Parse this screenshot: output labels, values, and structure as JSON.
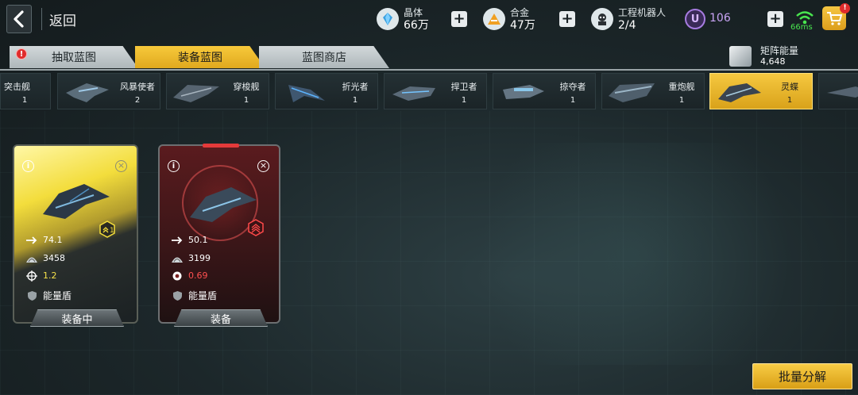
{
  "nav": {
    "back_label": "返回"
  },
  "resources": {
    "crystal": {
      "label": "晶体",
      "value": "66万"
    },
    "alloy": {
      "label": "合金",
      "value": "47万"
    },
    "robots": {
      "label": "工程机器人",
      "value": "2/4"
    },
    "u_currency": {
      "symbol": "U",
      "value": "106"
    },
    "plus_symbol": "+"
  },
  "network": {
    "latency": "66ms"
  },
  "cart": {
    "badge": "!"
  },
  "tabs": [
    {
      "label": "抽取蓝图",
      "alert": "!"
    },
    {
      "label": "装备蓝图"
    },
    {
      "label": "蓝图商店"
    }
  ],
  "matrix": {
    "label": "矩阵能量",
    "value": "4,648"
  },
  "ships": [
    {
      "name": "突击舰",
      "count": "1"
    },
    {
      "name": "风暴使者",
      "count": "2"
    },
    {
      "name": "穿梭舰",
      "count": "1"
    },
    {
      "name": "折光者",
      "count": "1"
    },
    {
      "name": "捍卫者",
      "count": "1"
    },
    {
      "name": "掠夺者",
      "count": "1"
    },
    {
      "name": "重炮舰",
      "count": "1"
    },
    {
      "name": "灵蝶",
      "count": "1"
    }
  ],
  "cards": [
    {
      "rarity": "gold",
      "info": "i",
      "close": "×",
      "rank": "1",
      "speed": "74.1",
      "armor": "3458",
      "accuracy": "1.2",
      "shield": "能量盾",
      "button": "装备中"
    },
    {
      "rarity": "red",
      "info": "i",
      "close": "×",
      "speed": "50.1",
      "armor": "3199",
      "accuracy": "0.69",
      "shield": "能量盾",
      "button": "装备"
    }
  ],
  "footer": {
    "bulk_button": "批量分解"
  },
  "colors": {
    "accent": "#f5c840",
    "red_stat": "#ff5050",
    "yellow_stat": "#f6e24a",
    "latency_green": "#49e54f",
    "u_purple": "#c9a4f5"
  }
}
